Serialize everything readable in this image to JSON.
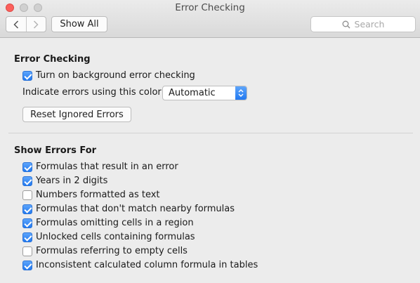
{
  "window": {
    "title": "Error Checking"
  },
  "toolbar": {
    "back_icon": "chevron-left-icon",
    "forward_icon": "chevron-right-icon",
    "show_all_label": "Show All",
    "search_placeholder": "Search"
  },
  "error_checking": {
    "heading": "Error Checking",
    "background_checking": {
      "label": "Turn on background error checking",
      "checked": true
    },
    "color_label": "Indicate errors using this color:",
    "color_value": "Automatic",
    "reset_label": "Reset Ignored Errors"
  },
  "show_errors_for": {
    "heading": "Show Errors For",
    "items": [
      {
        "label": "Formulas that result in an error",
        "checked": true
      },
      {
        "label": "Years in 2 digits",
        "checked": true
      },
      {
        "label": "Numbers formatted as text",
        "checked": false
      },
      {
        "label": "Formulas that don't match nearby formulas",
        "checked": true
      },
      {
        "label": "Formulas omitting cells in a region",
        "checked": true
      },
      {
        "label": "Unlocked cells containing formulas",
        "checked": true
      },
      {
        "label": "Formulas referring to empty cells",
        "checked": false
      },
      {
        "label": "Inconsistent calculated column formula in tables",
        "checked": true
      }
    ]
  },
  "colors": {
    "accent": "#2279f0",
    "close_button": "#fc605c"
  }
}
